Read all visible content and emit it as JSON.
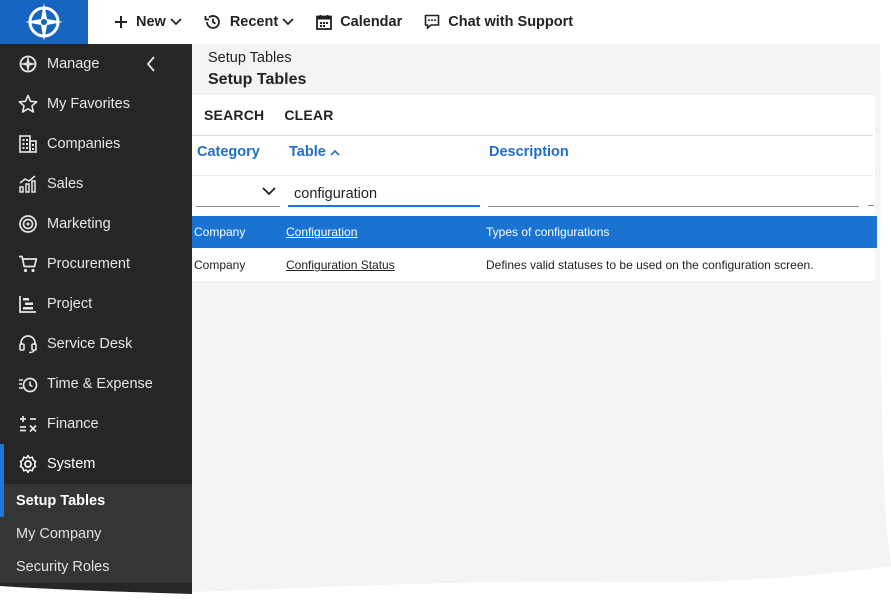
{
  "topbar": {
    "new_label": "New",
    "recent_label": "Recent",
    "calendar_label": "Calendar",
    "chat_label": "Chat with Support"
  },
  "sidebar": {
    "items": [
      {
        "label": "Manage",
        "icon": "compass-icon"
      },
      {
        "label": "My Favorites",
        "icon": "star-icon"
      },
      {
        "label": "Companies",
        "icon": "building-icon"
      },
      {
        "label": "Sales",
        "icon": "chart-icon"
      },
      {
        "label": "Marketing",
        "icon": "target-icon"
      },
      {
        "label": "Procurement",
        "icon": "cart-icon"
      },
      {
        "label": "Project",
        "icon": "gantt-icon"
      },
      {
        "label": "Service Desk",
        "icon": "headset-icon"
      },
      {
        "label": "Time & Expense",
        "icon": "clock-money-icon"
      },
      {
        "label": "Finance",
        "icon": "calculator-icon"
      },
      {
        "label": "System",
        "icon": "gear-icon"
      }
    ],
    "sub_items": [
      {
        "label": "Setup Tables"
      },
      {
        "label": "My Company"
      },
      {
        "label": "Security Roles"
      }
    ]
  },
  "main": {
    "breadcrumb": "Setup Tables",
    "title": "Setup Tables",
    "actions": {
      "search": "SEARCH",
      "clear": "CLEAR"
    },
    "columns": {
      "category": "Category",
      "table": "Table",
      "description": "Description"
    },
    "filters": {
      "table_value": "configuration",
      "category_value": "",
      "description_value": ""
    },
    "rows": [
      {
        "category": "Company",
        "table": "Configuration",
        "description": "Types of configurations",
        "selected": true
      },
      {
        "category": "Company",
        "table": "Configuration Status",
        "description": "Defines valid statuses to be used on the configuration screen.",
        "selected": false
      }
    ]
  },
  "colors": {
    "brand": "#1565c0",
    "sidebar_bg": "#262626",
    "accent": "#1e78d7",
    "selected_row": "#1a73d0",
    "header_link": "#1f6fc9"
  }
}
